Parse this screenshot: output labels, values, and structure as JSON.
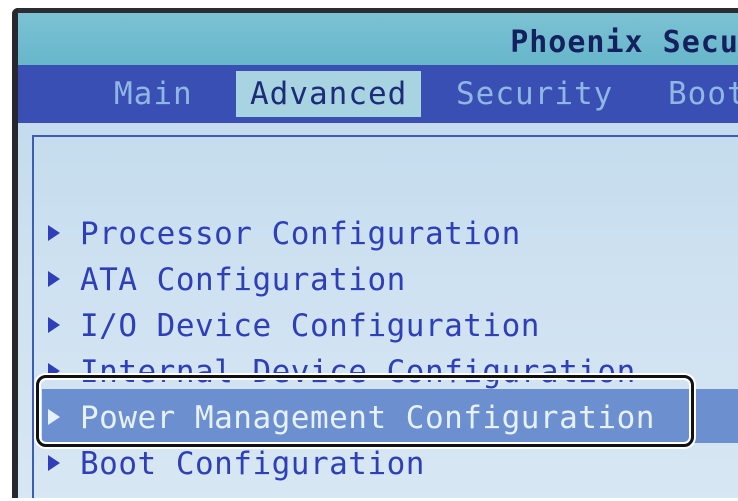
{
  "header": {
    "title": "Phoenix Secur"
  },
  "menu_bar": {
    "tabs": [
      {
        "label": "Main",
        "active": false
      },
      {
        "label": "Advanced",
        "active": true
      },
      {
        "label": "Security",
        "active": false
      },
      {
        "label": "Boot",
        "active": false
      }
    ]
  },
  "advanced_menu": {
    "items": [
      {
        "label": "Processor Configuration"
      },
      {
        "label": "ATA Configuration"
      },
      {
        "label": "I/O Device Configuration"
      },
      {
        "label": "Internal Device Configuration"
      },
      {
        "label": "Power Management Configuration",
        "selected": true
      },
      {
        "label": "Boot Configuration"
      }
    ]
  },
  "colors": {
    "title_bar": "#6ab8cb",
    "menu_bar": "#3a4fb4",
    "active_tab": "#a8d4e2",
    "content_bg": "#cfe2f1",
    "item_text": "#2f3fb8",
    "selection": "#6c8fcf",
    "highlight_outline": "#111111"
  },
  "icons": {
    "item_marker": "triangle-right-icon"
  }
}
